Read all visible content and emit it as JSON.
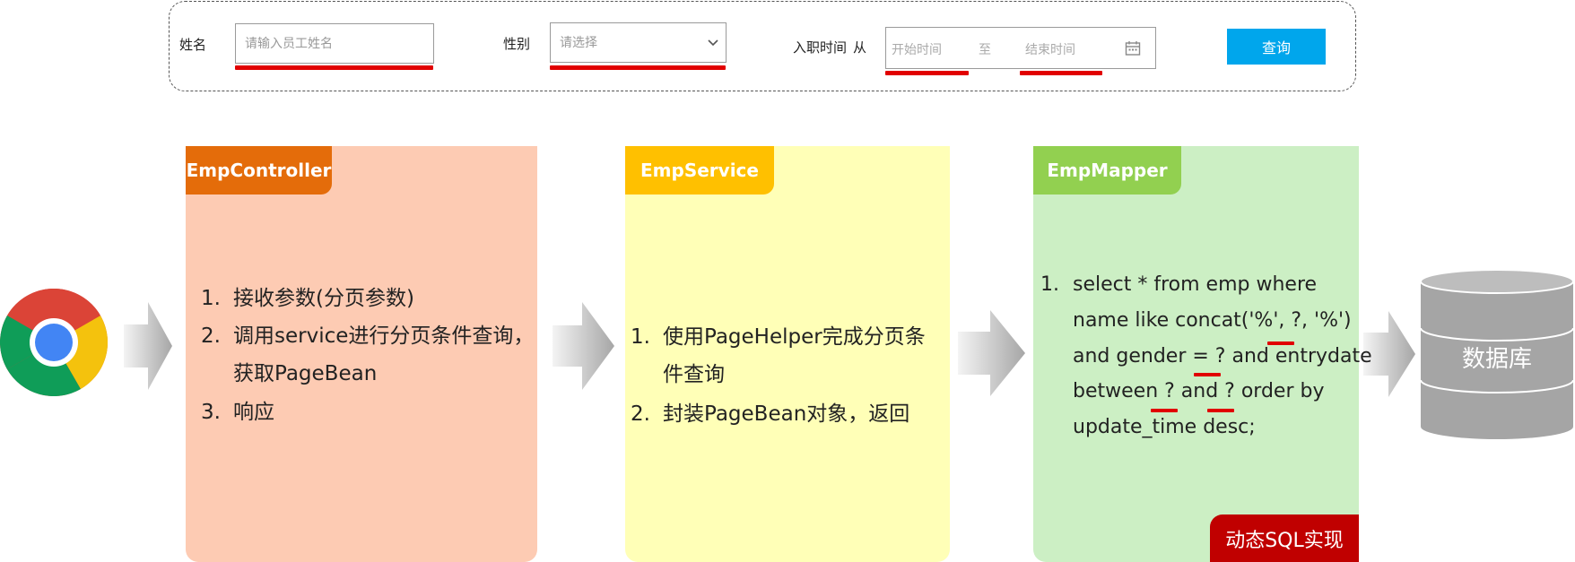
{
  "form": {
    "name_label": "姓名",
    "name_placeholder": "请输入员工姓名",
    "gender_label": "性别",
    "gender_placeholder": "请选择",
    "date_label": "入职时间",
    "from_label": "从",
    "start_placeholder": "开始时间",
    "to_label": "至",
    "end_placeholder": "结束时间",
    "query_button": "查询"
  },
  "controller": {
    "title": "EmpController",
    "steps": [
      {
        "num": "1.",
        "lines": [
          "接收参数(分页参数)"
        ]
      },
      {
        "num": "2.",
        "lines": [
          "调用service进行分页条件查询，",
          "获取PageBean"
        ]
      },
      {
        "num": "3.",
        "lines": [
          "响应"
        ]
      }
    ]
  },
  "service": {
    "title": "EmpService",
    "steps": [
      {
        "num": "1.",
        "lines": [
          "使用PageHelper完成分页条",
          "件查询"
        ]
      },
      {
        "num": "2.",
        "lines": [
          "封装PageBean对象，返回"
        ]
      }
    ]
  },
  "mapper": {
    "title": "EmpMapper",
    "step_num": "1.",
    "sql_lines": [
      "select * from emp where",
      "name like concat('%', ?, '%')",
      "and gender = ? and entrydate",
      "between ? and ?  order by",
      "update_time desc;"
    ],
    "badge": "动态SQL实现"
  },
  "database": {
    "label": "数据库"
  },
  "colors": {
    "controller_tag": "#e46c0a",
    "controller_body": "#fdcbb3",
    "service_tag": "#ffc000",
    "service_body": "#ffffb7",
    "mapper_tag": "#92d050",
    "mapper_body": "#ccefc4",
    "highlight": "#e10000",
    "query_button": "#00a6ec"
  }
}
